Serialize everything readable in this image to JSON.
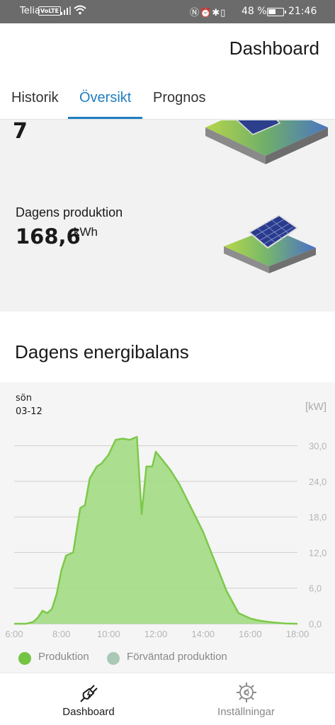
{
  "status_bar": {
    "carrier": "Telia",
    "volte": "VoLTE",
    "battery_pct": "48 %",
    "time": "21:46"
  },
  "header": {
    "title": "Dashboard"
  },
  "tabs": [
    {
      "label": "Historik",
      "active": false
    },
    {
      "label": "Översikt",
      "active": true
    },
    {
      "label": "Prognos",
      "active": false
    }
  ],
  "overview": {
    "top_partial": "7",
    "production_label": "Dagens produktion",
    "production_value": "168,6",
    "production_unit": "kWh"
  },
  "balance": {
    "title": "Dagens energibalans",
    "day": "sön",
    "date": "03-12",
    "unit": "[kW]"
  },
  "chart_data": {
    "type": "area",
    "xlabel": "",
    "ylabel": "[kW]",
    "xlim": [
      6,
      18
    ],
    "ylim": [
      0,
      31.5
    ],
    "x_ticks": [
      "6:00",
      "8:00",
      "10:00",
      "12:00",
      "14:00",
      "16:00",
      "18:00"
    ],
    "y_ticks": [
      "0,0",
      "6,0",
      "12,0",
      "18,0",
      "24,0",
      "30,0"
    ],
    "grid": true,
    "colors": {
      "production": "#7dc94a",
      "production_fill": "#a3dc84",
      "expected": "#a9c9b6"
    },
    "series": [
      {
        "name": "Produktion",
        "x": [
          6.0,
          6.5,
          6.8,
          7.0,
          7.2,
          7.4,
          7.6,
          7.8,
          8.0,
          8.2,
          8.5,
          8.8,
          9.0,
          9.2,
          9.5,
          9.7,
          10.0,
          10.3,
          10.6,
          10.9,
          11.2,
          11.4,
          11.6,
          11.85,
          12.0,
          12.2,
          12.4,
          12.6,
          13.0,
          13.5,
          14.0,
          14.5,
          15.0,
          15.5,
          16.0,
          16.3,
          16.6,
          17.0,
          17.5,
          18.0
        ],
        "y": [
          0.0,
          0.0,
          0.3,
          1.0,
          2.2,
          1.8,
          2.5,
          5.0,
          9.0,
          11.5,
          12.0,
          19.5,
          20.0,
          24.5,
          26.5,
          27.0,
          28.5,
          31.0,
          31.2,
          31.0,
          31.5,
          18.5,
          26.5,
          26.5,
          29.0,
          28.0,
          27.0,
          26.0,
          23.5,
          19.5,
          15.5,
          10.5,
          5.5,
          1.8,
          0.9,
          0.6,
          0.4,
          0.2,
          0.05,
          0.0
        ]
      },
      {
        "name": "Förväntad produktion",
        "x": [],
        "y": []
      }
    ]
  },
  "legend": [
    {
      "label": "Produktion",
      "color": "#74c443"
    },
    {
      "label": "Förväntad produktion",
      "color": "#a9c9b6"
    }
  ],
  "bottom_nav": [
    {
      "label": "Dashboard",
      "icon": "plug-icon",
      "active": true
    },
    {
      "label": "Inställningar",
      "icon": "gear-sun-icon",
      "active": false
    }
  ]
}
